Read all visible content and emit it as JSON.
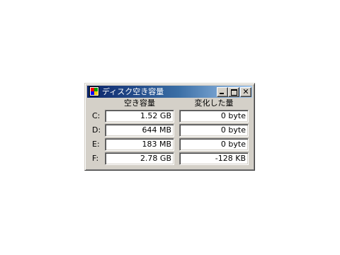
{
  "window": {
    "title": "ディスク空き容量",
    "close_glyph": "✕"
  },
  "columns": {
    "free_space": "空き容量",
    "change": "変化した量"
  },
  "drives": [
    {
      "label": "C:",
      "free": "1.52 GB",
      "change": "0 byte"
    },
    {
      "label": "D:",
      "free": "644 MB",
      "change": "0 byte"
    },
    {
      "label": "E:",
      "free": "183 MB",
      "change": "0 byte"
    },
    {
      "label": "F:",
      "free": "2.78 GB",
      "change": "-128 KB"
    }
  ],
  "icons": {
    "app": "disk-space-app-icon",
    "minimize": "minimize-icon",
    "maximize": "maximize-icon",
    "close": "close-icon"
  },
  "colors": {
    "titlebar_start": "#0a246a",
    "titlebar_end": "#a6caf0",
    "window_face": "#d4d0c8"
  }
}
